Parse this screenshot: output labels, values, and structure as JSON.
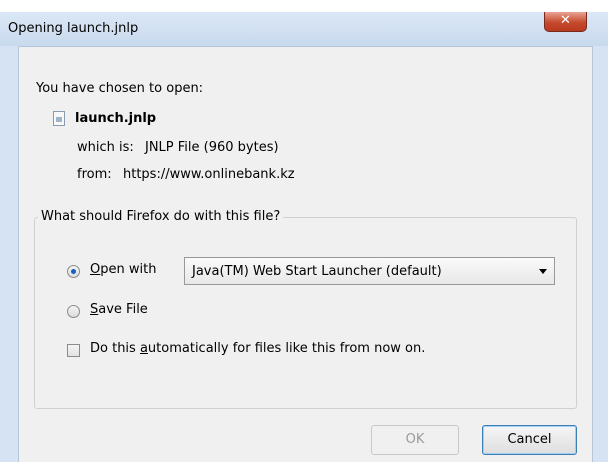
{
  "window": {
    "title": "Opening launch.jnlp",
    "close_glyph": "✕"
  },
  "intro": "You have chosen to open:",
  "file": {
    "name": "launch.jnlp",
    "which_is_label": "which is:",
    "which_is_value": "JNLP File (960 bytes)",
    "from_label": "from:",
    "from_value": "https://www.onlinebank.kz",
    "icon": "file-icon"
  },
  "action_group": {
    "label": "What should Firefox do with this file?",
    "open_with": {
      "prefix": "",
      "mnemonic": "O",
      "rest": "pen with",
      "checked": true
    },
    "open_with_app": "Java(TM) Web Start Launcher (default)",
    "save_file": {
      "mnemonic": "S",
      "rest": "ave File",
      "checked": false
    },
    "auto": {
      "before": "Do this ",
      "mnemonic": "a",
      "after": "utomatically for files like this from now on.",
      "checked": false
    }
  },
  "buttons": {
    "ok": "OK",
    "cancel": "Cancel"
  }
}
